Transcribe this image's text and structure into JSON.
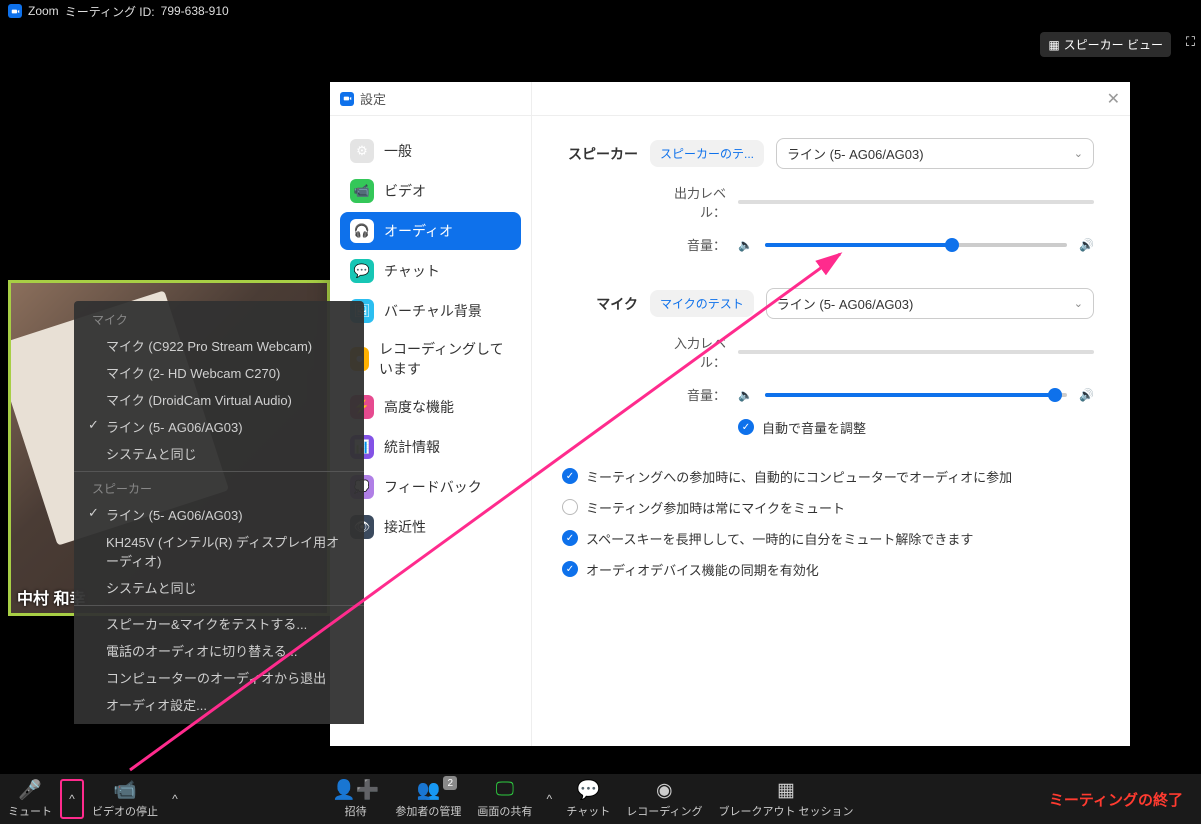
{
  "titlebar": {
    "app": "Zoom",
    "meeting_label": "ミーティング ID:",
    "meeting_id": "799-638-910"
  },
  "speaker_view": "スピーカー ビュー",
  "video": {
    "participant_name": "中村 和幸"
  },
  "audio_menu": {
    "mic_header": "マイク",
    "mic_items": [
      {
        "label": "マイク (C922 Pro Stream Webcam)",
        "checked": false
      },
      {
        "label": "マイク (2- HD Webcam C270)",
        "checked": false
      },
      {
        "label": "マイク (DroidCam Virtual Audio)",
        "checked": false
      },
      {
        "label": "ライン (5- AG06/AG03)",
        "checked": true
      },
      {
        "label": "システムと同じ",
        "checked": false
      }
    ],
    "speaker_header": "スピーカー",
    "speaker_items": [
      {
        "label": "ライン (5- AG06/AG03)",
        "checked": true
      },
      {
        "label": "KH245V (インテル(R) ディスプレイ用オーディオ)",
        "checked": false
      },
      {
        "label": "システムと同じ",
        "checked": false
      }
    ],
    "footer": [
      "スピーカー&マイクをテストする...",
      "電話のオーディオに切り替える...",
      "コンピューターのオーディオから退出",
      "オーディオ設定..."
    ]
  },
  "settings": {
    "title": "設定",
    "nav": [
      {
        "label": "一般",
        "color": "#e4e4e4"
      },
      {
        "label": "ビデオ",
        "color": "#34c759"
      },
      {
        "label": "オーディオ",
        "color": "#0e71eb",
        "active": true
      },
      {
        "label": "チャット",
        "color": "#17c6b5"
      },
      {
        "label": "バーチャル背景",
        "color": "#2bbef0"
      },
      {
        "label": "レコーディングしています",
        "color": "#ffb100"
      },
      {
        "label": "高度な機能",
        "color": "#e64a8f"
      },
      {
        "label": "統計情報",
        "color": "#8352e6"
      },
      {
        "label": "フィードバック",
        "color": "#b07fe6"
      },
      {
        "label": "接近性",
        "color": "#3b4a5e"
      }
    ],
    "speaker": {
      "label": "スピーカー",
      "test": "スピーカーのテ...",
      "device": "ライン (5- AG06/AG03)",
      "out_level": "出力レベル：",
      "volume": "音量：",
      "volume_pct": 62
    },
    "mic": {
      "label": "マイク",
      "test": "マイクのテスト",
      "device": "ライン (5- AG06/AG03)",
      "in_level": "入力レベル：",
      "volume": "音量：",
      "volume_pct": 96,
      "auto": "自動で音量を調整"
    },
    "opts": {
      "auto_join": "ミーティングへの参加時に、自動的にコンピューターでオーディオに参加",
      "mute_on_join": "ミーティング参加時は常にマイクをミュート",
      "spacekey": "スペースキーを長押しして、一時的に自分をミュート解除できます",
      "sync": "オーディオデバイス機能の同期を有効化"
    }
  },
  "toolbar": {
    "mute": "ミュート",
    "stop_video": "ビデオの停止",
    "invite": "招待",
    "manage": "参加者の管理",
    "participants_count": "2",
    "share": "画面の共有",
    "chat": "チャット",
    "recording": "レコーディング",
    "breakout": "ブレークアウト セッション",
    "end": "ミーティングの終了"
  }
}
